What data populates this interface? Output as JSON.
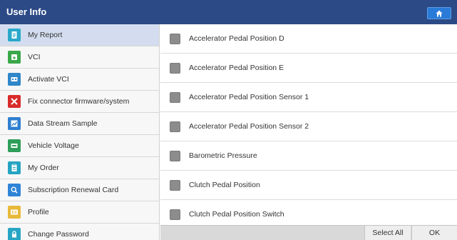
{
  "app": {
    "title": "User Info"
  },
  "header": {
    "home_icon": "home-icon",
    "home_color": "#2a7bd8"
  },
  "sidebar": {
    "items": [
      {
        "label": "My Report",
        "icon": "report-icon",
        "color": "#2aa8c9",
        "active": true
      },
      {
        "label": "VCI",
        "icon": "vci-icon",
        "color": "#3aa84a"
      },
      {
        "label": "Activate VCI",
        "icon": "activate-vci-icon",
        "color": "#2f86c8"
      },
      {
        "label": "Fix connector firmware/system",
        "icon": "repair-icon",
        "color": "#d92b2b"
      },
      {
        "label": "Data Stream Sample",
        "icon": "chart-icon",
        "color": "#2f7fd0"
      },
      {
        "label": "Vehicle Voltage",
        "icon": "battery-icon",
        "color": "#2e9e5a"
      },
      {
        "label": "My Order",
        "icon": "order-icon",
        "color": "#25a3c2"
      },
      {
        "label": "Subscription Renewal Card",
        "icon": "search-card-icon",
        "color": "#2f84d6"
      },
      {
        "label": "Profile",
        "icon": "profile-card-icon",
        "color": "#e8b93a"
      },
      {
        "label": "Change Password",
        "icon": "lock-icon",
        "color": "#27a5c4"
      }
    ]
  },
  "list": {
    "items": [
      {
        "label": "Accelerator Pedal Position D",
        "checked": false
      },
      {
        "label": "Accelerator Pedal Position E",
        "checked": false
      },
      {
        "label": "Accelerator Pedal Position Sensor 1",
        "checked": false
      },
      {
        "label": "Accelerator Pedal Position Sensor 2",
        "checked": false
      },
      {
        "label": "Barometric Pressure",
        "checked": false
      },
      {
        "label": "Clutch Pedal Position",
        "checked": false
      },
      {
        "label": "Clutch Pedal Position Switch",
        "checked": false
      }
    ]
  },
  "footer": {
    "select_all_label": "Select All",
    "ok_label": "OK"
  },
  "colors": {
    "header_bg": "#2b4a86",
    "active_item_bg": "#d3ddef",
    "checkbox": "#8c8c8c"
  }
}
